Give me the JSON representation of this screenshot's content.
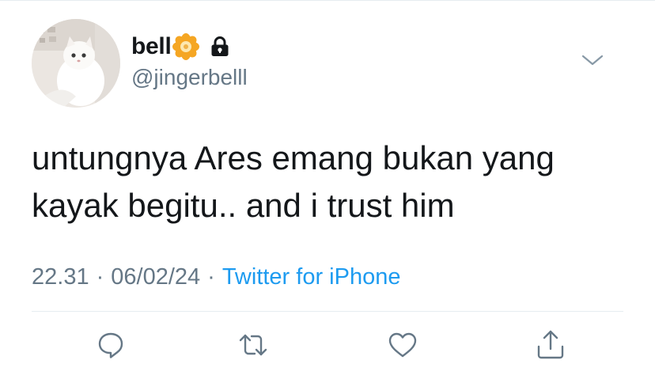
{
  "profile": {
    "display_name": "bell",
    "handle": "@jingerbelll",
    "name_emoji": "flower-icon",
    "protected_icon": "lock-icon"
  },
  "tweet": {
    "text_line1": "untungnya Ares emang bukan yang",
    "text_line2": "kayak begitu.. and i trust him"
  },
  "meta": {
    "time": "22.31",
    "separator": "·",
    "date": "06/02/24",
    "source": "Twitter for iPhone"
  },
  "actions": [
    "reply-icon",
    "retweet-icon",
    "like-icon",
    "share-icon"
  ],
  "colors": {
    "text": "#14171a",
    "secondary": "#657786",
    "link": "#1d9bf0",
    "divider": "#e6ecf0"
  }
}
